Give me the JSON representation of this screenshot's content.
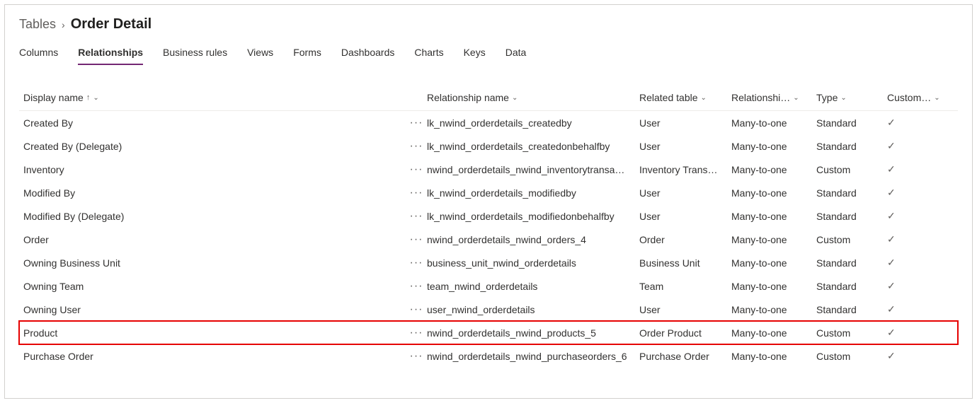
{
  "breadcrumb": {
    "parent": "Tables",
    "current": "Order Detail"
  },
  "tabs": [
    {
      "label": "Columns",
      "active": false
    },
    {
      "label": "Relationships",
      "active": true
    },
    {
      "label": "Business rules",
      "active": false
    },
    {
      "label": "Views",
      "active": false
    },
    {
      "label": "Forms",
      "active": false
    },
    {
      "label": "Dashboards",
      "active": false
    },
    {
      "label": "Charts",
      "active": false
    },
    {
      "label": "Keys",
      "active": false
    },
    {
      "label": "Data",
      "active": false
    }
  ],
  "columns": {
    "display_name": "Display name",
    "relationship_name": "Relationship name",
    "related_table": "Related table",
    "relationship_type": "Relationshi…",
    "type": "Type",
    "customizable": "Custom…"
  },
  "sort": {
    "column": "display_name",
    "direction": "asc"
  },
  "rows": [
    {
      "display_name": "Created By",
      "relationship_name": "lk_nwind_orderdetails_createdby",
      "related_table": "User",
      "relationship_type": "Many-to-one",
      "type": "Standard",
      "customizable": true,
      "highlight": false
    },
    {
      "display_name": "Created By (Delegate)",
      "relationship_name": "lk_nwind_orderdetails_createdonbehalfby",
      "related_table": "User",
      "relationship_type": "Many-to-one",
      "type": "Standard",
      "customizable": true,
      "highlight": false
    },
    {
      "display_name": "Inventory",
      "relationship_name": "nwind_orderdetails_nwind_inventorytransa…",
      "related_table": "Inventory Trans…",
      "relationship_type": "Many-to-one",
      "type": "Custom",
      "customizable": true,
      "highlight": false
    },
    {
      "display_name": "Modified By",
      "relationship_name": "lk_nwind_orderdetails_modifiedby",
      "related_table": "User",
      "relationship_type": "Many-to-one",
      "type": "Standard",
      "customizable": true,
      "highlight": false
    },
    {
      "display_name": "Modified By (Delegate)",
      "relationship_name": "lk_nwind_orderdetails_modifiedonbehalfby",
      "related_table": "User",
      "relationship_type": "Many-to-one",
      "type": "Standard",
      "customizable": true,
      "highlight": false
    },
    {
      "display_name": "Order",
      "relationship_name": "nwind_orderdetails_nwind_orders_4",
      "related_table": "Order",
      "relationship_type": "Many-to-one",
      "type": "Custom",
      "customizable": true,
      "highlight": false
    },
    {
      "display_name": "Owning Business Unit",
      "relationship_name": "business_unit_nwind_orderdetails",
      "related_table": "Business Unit",
      "relationship_type": "Many-to-one",
      "type": "Standard",
      "customizable": true,
      "highlight": false
    },
    {
      "display_name": "Owning Team",
      "relationship_name": "team_nwind_orderdetails",
      "related_table": "Team",
      "relationship_type": "Many-to-one",
      "type": "Standard",
      "customizable": true,
      "highlight": false
    },
    {
      "display_name": "Owning User",
      "relationship_name": "user_nwind_orderdetails",
      "related_table": "User",
      "relationship_type": "Many-to-one",
      "type": "Standard",
      "customizable": true,
      "highlight": false
    },
    {
      "display_name": "Product",
      "relationship_name": "nwind_orderdetails_nwind_products_5",
      "related_table": "Order Product",
      "relationship_type": "Many-to-one",
      "type": "Custom",
      "customizable": true,
      "highlight": true
    },
    {
      "display_name": "Purchase Order",
      "relationship_name": "nwind_orderdetails_nwind_purchaseorders_6",
      "related_table": "Purchase Order",
      "relationship_type": "Many-to-one",
      "type": "Custom",
      "customizable": true,
      "highlight": false
    }
  ],
  "glyphs": {
    "more": "···",
    "check": "✓",
    "chevron_down": "⌄",
    "chevron_right": "›",
    "sort_asc": "↑"
  }
}
